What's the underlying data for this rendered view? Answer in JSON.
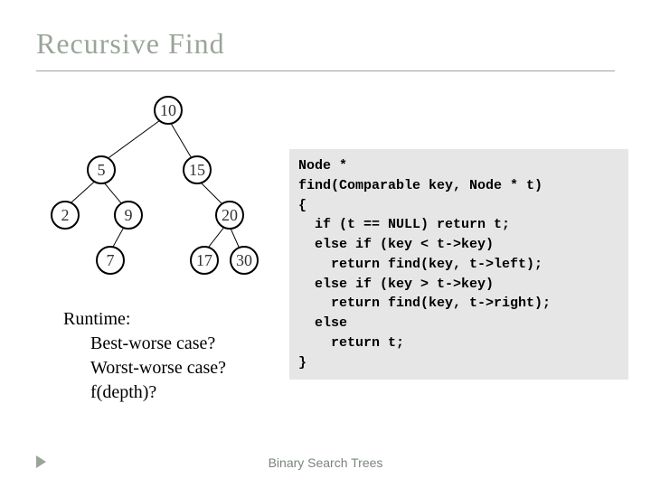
{
  "title": "Recursive Find",
  "footer": "Binary Search Trees",
  "tree": {
    "nodes": {
      "n10": "10",
      "n5": "5",
      "n15": "15",
      "n2": "2",
      "n9": "9",
      "n20": "20",
      "n7": "7",
      "n17": "17",
      "n30": "30"
    }
  },
  "runtime": {
    "heading": "Runtime:",
    "q1": "Best-worse case?",
    "q2": "Worst-worse case?",
    "q3": "f(depth)?"
  },
  "code": {
    "l1": "Node *",
    "l2": "find(Comparable key, Node * t)",
    "l3": "{",
    "l4": "  if (t == NULL) return t;",
    "l5": "  else if (key < t->key)",
    "l6": "    return find(key, t->left);",
    "l7": "  else if (key > t->key)",
    "l8": "    return find(key, t->right);",
    "l9": "  else",
    "l10": "    return t;",
    "l11": "}"
  }
}
